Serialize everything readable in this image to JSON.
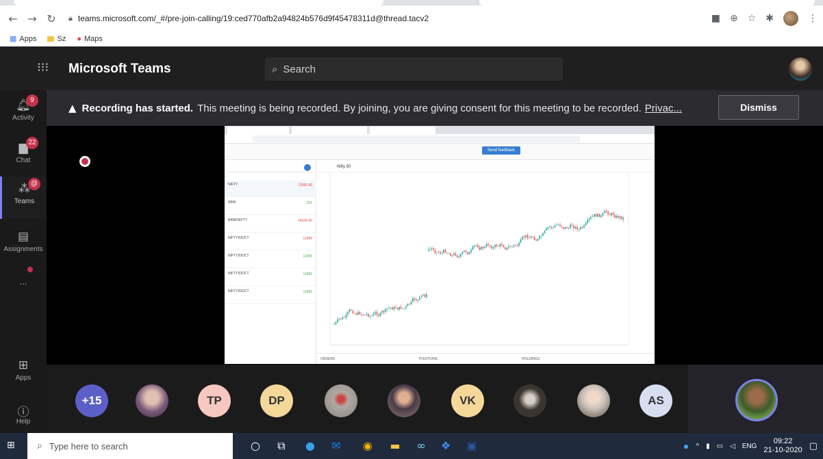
{
  "browser": {
    "url": "teams.microsoft.com/_#/pre-join-calling/19:ced770afb2a94824b576d9f45478311d@thread.tacv2",
    "bookmarks": [
      "Apps",
      "Sz",
      "Maps"
    ]
  },
  "teams": {
    "app_title": "Microsoft Teams",
    "search_placeholder": "Search"
  },
  "rail": [
    {
      "label": "Activity",
      "icon": "bell-icon",
      "badge": "9"
    },
    {
      "label": "Chat",
      "icon": "chat-icon",
      "badge": "22"
    },
    {
      "label": "Teams",
      "icon": "teams-icon",
      "badge": "@"
    },
    {
      "label": "Assignments",
      "icon": "assignments-icon",
      "badge": ""
    },
    {
      "label": "...",
      "icon": "more-icon",
      "badge": ""
    },
    {
      "label": "Apps",
      "icon": "apps-icon",
      "badge": ""
    },
    {
      "label": "Help",
      "icon": "help-icon",
      "badge": ""
    }
  ],
  "banner": {
    "title": "Recording has started.",
    "message": "This meeting is being recorded. By joining, you are giving consent for this meeting to be recorded.",
    "link": "Privac...",
    "dismiss": "Dismiss"
  },
  "shared_screen": {
    "feedback_button": "Send feedback",
    "chart_title": "Nifty 50",
    "watchlist": [
      {
        "name": "NIFTY",
        "price": "11896.80",
        "up": false
      },
      {
        "name": "SBIN",
        "price": "203",
        "up": true
      },
      {
        "name": "BANKNIFTY",
        "price": "24634.90",
        "up": false
      },
      {
        "name": "NIFTY20OCT",
        "price": "11898",
        "up": false
      },
      {
        "name": "NIFTY20OCT",
        "price": "11896",
        "up": true
      },
      {
        "name": "NIFTY20OCT",
        "price": "11896",
        "up": true
      },
      {
        "name": "NIFTY20OCT",
        "price": "11896",
        "up": true
      }
    ],
    "bottom_tabs": [
      "ORDERS",
      "POSITIONS",
      "HOLDINGS"
    ]
  },
  "participants": [
    {
      "initials": "+15",
      "color": "#5b5fc7",
      "text_color": "#ffffff",
      "photo": false
    },
    {
      "initials": "",
      "color": "#7a5a7a",
      "photo": true
    },
    {
      "initials": "TP",
      "color": "#f7c8c0",
      "text_color": "#3a3a3a",
      "photo": false
    },
    {
      "initials": "DP",
      "color": "#f4d89a",
      "text_color": "#3a3a3a",
      "photo": false
    },
    {
      "initials": "",
      "color": "#b0a9a4",
      "photo": true
    },
    {
      "initials": "",
      "color": "#8a7a6a",
      "photo": true
    },
    {
      "initials": "VK",
      "color": "#f4d89a",
      "text_color": "#3a3a3a",
      "photo": false
    },
    {
      "initials": "",
      "color": "#3a3530",
      "photo": true
    },
    {
      "initials": "",
      "color": "#c8c0b8",
      "photo": true
    },
    {
      "initials": "AS",
      "color": "#d8ddf0",
      "text_color": "#3a3a3a",
      "photo": false
    }
  ],
  "taskbar": {
    "search_placeholder": "Type here to search",
    "language": "ENG",
    "time": "09:22",
    "date": "21-10-2020"
  }
}
